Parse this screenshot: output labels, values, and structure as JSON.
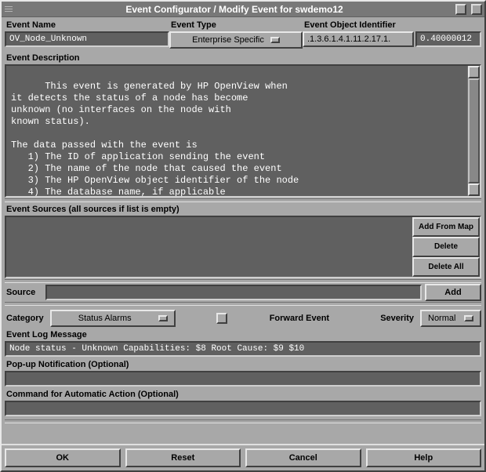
{
  "window": {
    "title": "Event Configurator / Modify Event for swdemo12"
  },
  "labels": {
    "event_name": "Event Name",
    "event_type": "Event Type",
    "event_oid": "Event Object Identifier",
    "event_desc": "Event Description",
    "event_sources": "Event Sources (all sources if list is empty)",
    "source": "Source",
    "category": "Category",
    "forward_event": "Forward Event",
    "severity": "Severity",
    "event_log_msg": "Event Log Message",
    "popup": "Pop-up Notification (Optional)",
    "command": "Command for Automatic Action (Optional)"
  },
  "fields": {
    "event_name": "OV_Node_Unknown",
    "event_type": "Enterprise Specific",
    "oid_prefix": ".1.3.6.1.4.1.11.2.17.1.",
    "oid_value": "0.40000012",
    "description": "This event is generated by HP OpenView when\nit detects the status of a node has become\nunknown (no interfaces on the node with\nknown status).\n\nThe data passed with the event is\n   1) The ID of application sending the event\n   2) The name of the node that caused the event\n   3) The HP OpenView object identifier of the node\n   4) The database name, if applicable",
    "source": "",
    "category": "Status Alarms",
    "severity": "Normal",
    "log_message": "Node status - Unknown  Capabilities: $8  Root Cause: $9 $10",
    "popup": "",
    "command": ""
  },
  "buttons": {
    "add_from_map": "Add From Map",
    "delete": "Delete",
    "delete_all": "Delete All",
    "add": "Add",
    "ok": "OK",
    "reset": "Reset",
    "cancel": "Cancel",
    "help": "Help"
  }
}
